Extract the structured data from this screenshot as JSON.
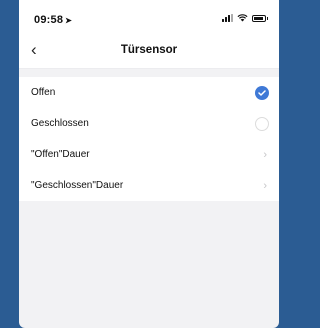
{
  "status_bar": {
    "time": "09:58"
  },
  "nav": {
    "back_icon": "chevron-left-icon",
    "title": "Türsensor"
  },
  "rows": [
    {
      "label": "Offen",
      "control": "checkmark",
      "selected": true
    },
    {
      "label": "Geschlossen",
      "control": "radio",
      "selected": false
    },
    {
      "label": "\"Offen\"Dauer",
      "control": "chevron"
    },
    {
      "label": "\"Geschlossen\"Dauer",
      "control": "chevron"
    }
  ],
  "colors": {
    "background_frame": "#2b5c93",
    "accent": "#3f79d6",
    "page_background": "#f2f2f4"
  }
}
